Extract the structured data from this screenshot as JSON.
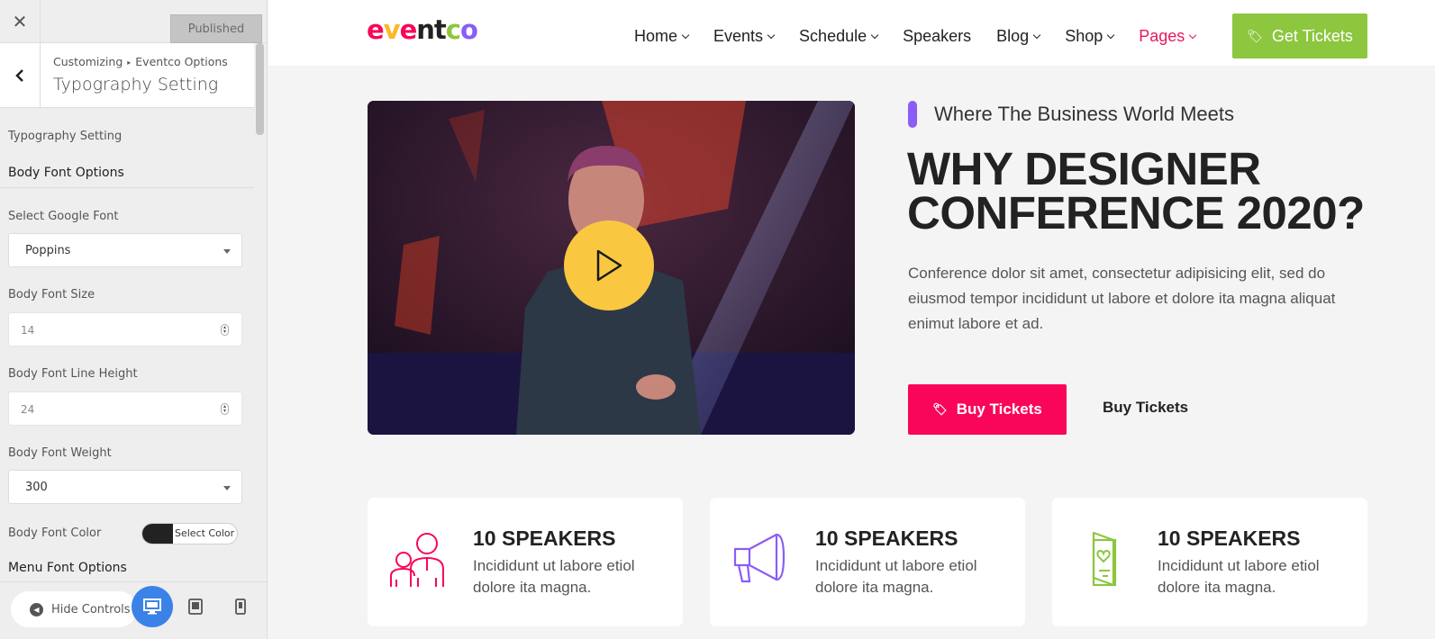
{
  "customizer": {
    "close_icon": "close-icon",
    "publish_label": "Published",
    "breadcrumb": {
      "root": "Customizing",
      "current": "Eventco Options"
    },
    "title": "Typography Setting",
    "section_label": "Typography Setting",
    "body_heading": "Body Font Options",
    "fields": {
      "google_font": {
        "label": "Select Google Font",
        "value": "Poppins"
      },
      "font_size": {
        "label": "Body Font Size",
        "value": "14"
      },
      "line_height": {
        "label": "Body Font Line Height",
        "value": "24"
      },
      "font_weight": {
        "label": "Body Font Weight",
        "value": "300"
      },
      "font_color": {
        "label": "Body Font Color",
        "button": "Select Color",
        "swatch": "#222222"
      }
    },
    "menu_heading": "Menu Font Options",
    "footer": {
      "hide_controls": "Hide Controls",
      "devices": [
        "desktop-icon",
        "tablet-icon",
        "mobile-icon"
      ]
    }
  },
  "site": {
    "logo": {
      "letters": [
        "e",
        "v",
        "e",
        "n",
        "t",
        "c",
        "o"
      ],
      "colors": [
        "#f9065a",
        "#fbb82a",
        "#f9065a",
        "#222222",
        "#222222",
        "#8dc63f",
        "#8b5cf6"
      ]
    },
    "nav": [
      {
        "label": "Home",
        "dropdown": true
      },
      {
        "label": "Events",
        "dropdown": true
      },
      {
        "label": "Schedule",
        "dropdown": true
      },
      {
        "label": "Speakers",
        "dropdown": false
      },
      {
        "label": "Blog",
        "dropdown": true
      },
      {
        "label": "Shop",
        "dropdown": true
      },
      {
        "label": "Pages",
        "dropdown": true
      }
    ],
    "cta": "Get Tickets",
    "hero": {
      "tagline": "Where The Business World Meets",
      "title_line1": "WHY DESIGNER",
      "title_line2": "CONFERENCE 2020?",
      "description": "Conference dolor sit amet, consectetur adipisicing elit, sed do eiusmod tempor incididunt ut labore et dolore ita magna aliquat enimut labore et ad.",
      "buy_primary": "Buy Tickets",
      "buy_secondary": "Buy Tickets"
    },
    "features": [
      {
        "title": "10 SPEAKERS",
        "desc": "Incididunt ut labore etiol dolore ita magna.",
        "icon": "speakers-icon"
      },
      {
        "title": "10 SPEAKERS",
        "desc": "Incididunt ut labore etiol dolore ita magna.",
        "icon": "megaphone-icon"
      },
      {
        "title": "10 SPEAKERS",
        "desc": "Incididunt ut labore etiol dolore ita magna.",
        "icon": "card-heart-icon"
      }
    ],
    "colors": {
      "primary": "#f9065a",
      "accent_green": "#8dc63f",
      "accent_purple": "#8b5cf6",
      "accent_yellow": "#fac840",
      "active_nav": "#e8195a"
    }
  }
}
